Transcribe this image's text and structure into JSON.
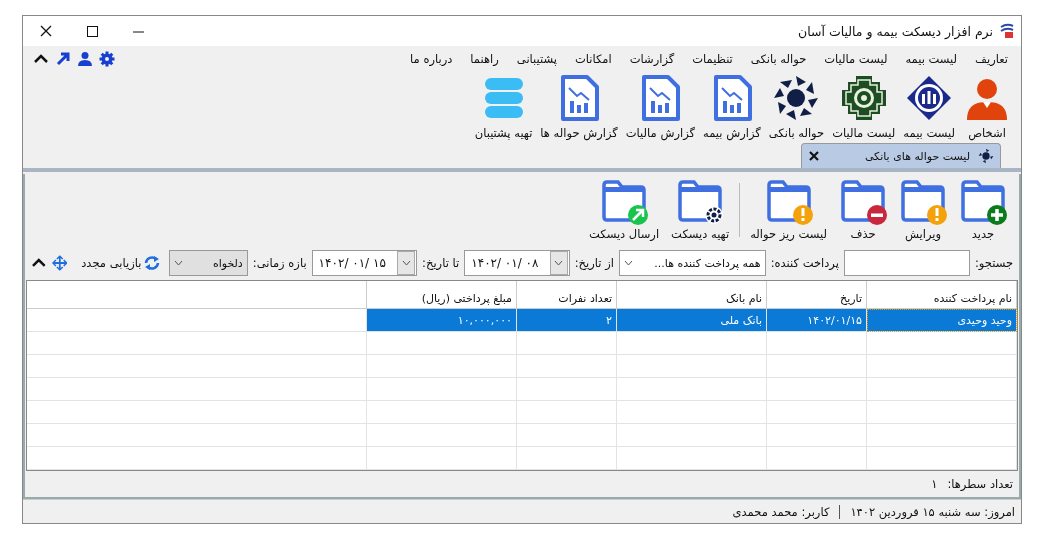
{
  "window": {
    "title": "نرم افزار دیسکت بیمه و مالیات آسان"
  },
  "menu": [
    {
      "label": "تعاریف"
    },
    {
      "label": "لیست بیمه"
    },
    {
      "label": "لیست مالیات"
    },
    {
      "label": "حواله بانکی"
    },
    {
      "label": "تنظیمات"
    },
    {
      "label": "گزارشات"
    },
    {
      "label": "امکانات"
    },
    {
      "label": "پشتیبانی"
    },
    {
      "label": "راهنما"
    },
    {
      "label": "درباره ما"
    }
  ],
  "ribbon": [
    {
      "label": "اشخاص",
      "kind": "person"
    },
    {
      "label": "لیست بیمه",
      "kind": "insurance"
    },
    {
      "label": "لیست مالیات",
      "kind": "tax"
    },
    {
      "label": "حواله بانکی",
      "kind": "bank"
    },
    {
      "label": "گزارش بیمه",
      "kind": "report"
    },
    {
      "label": "گزارش مالیات",
      "kind": "report"
    },
    {
      "label": "گزارش حواله ها",
      "kind": "report"
    },
    {
      "label": "تهیه پشتیبان",
      "kind": "database"
    }
  ],
  "tabs": [
    {
      "label": "لیست حواله های بانکی",
      "selected": true,
      "closable": true
    }
  ],
  "action_groups": [
    [
      {
        "label": "جدید",
        "kind": "add"
      },
      {
        "label": "ویرایش",
        "kind": "warn"
      },
      {
        "label": "حذف",
        "kind": "remove"
      },
      {
        "label": "لیست ریز حواله",
        "kind": "warn"
      }
    ],
    [
      {
        "label": "تهیه دیسکت",
        "kind": "bank"
      },
      {
        "label": "ارسال دیسکت",
        "kind": "send"
      }
    ]
  ],
  "filters": {
    "search": {
      "label": "جستجو:"
    },
    "payer": {
      "label": "پرداخت کننده:",
      "value": "همه پرداخت کننده ها..."
    },
    "from": {
      "label": "از تاریخ:",
      "value": "۱۴۰۲/ ۰۱/ ۰۸"
    },
    "to": {
      "label": "تا تاریخ:",
      "value": "۱۴۰۲/ ۰۱/ ۱۵"
    },
    "range": {
      "label": "بازه زمانی:",
      "value": "دلخواه"
    },
    "refresh": {
      "label": "بازیابی مجدد"
    }
  },
  "table": {
    "columns": [
      "نام پرداخت کننده",
      "تاریخ",
      "نام بانک",
      "تعداد نفرات",
      "مبلغ پرداختی (ریال)"
    ],
    "rows": [
      {
        "cells": [
          "وحید وحیدی",
          "۱۴۰۲/۰۱/۱۵",
          "بانک ملی",
          "۲",
          "۱۰,۰۰۰,۰۰۰"
        ],
        "selected": true
      }
    ]
  },
  "row_count": {
    "label": "تعداد سطرها:",
    "value": "۱"
  },
  "status_bar": {
    "today": "امروز: سه شنبه ۱۵ فروردین ۱۴۰۲",
    "user": "کاربر: محمد محمدی"
  }
}
